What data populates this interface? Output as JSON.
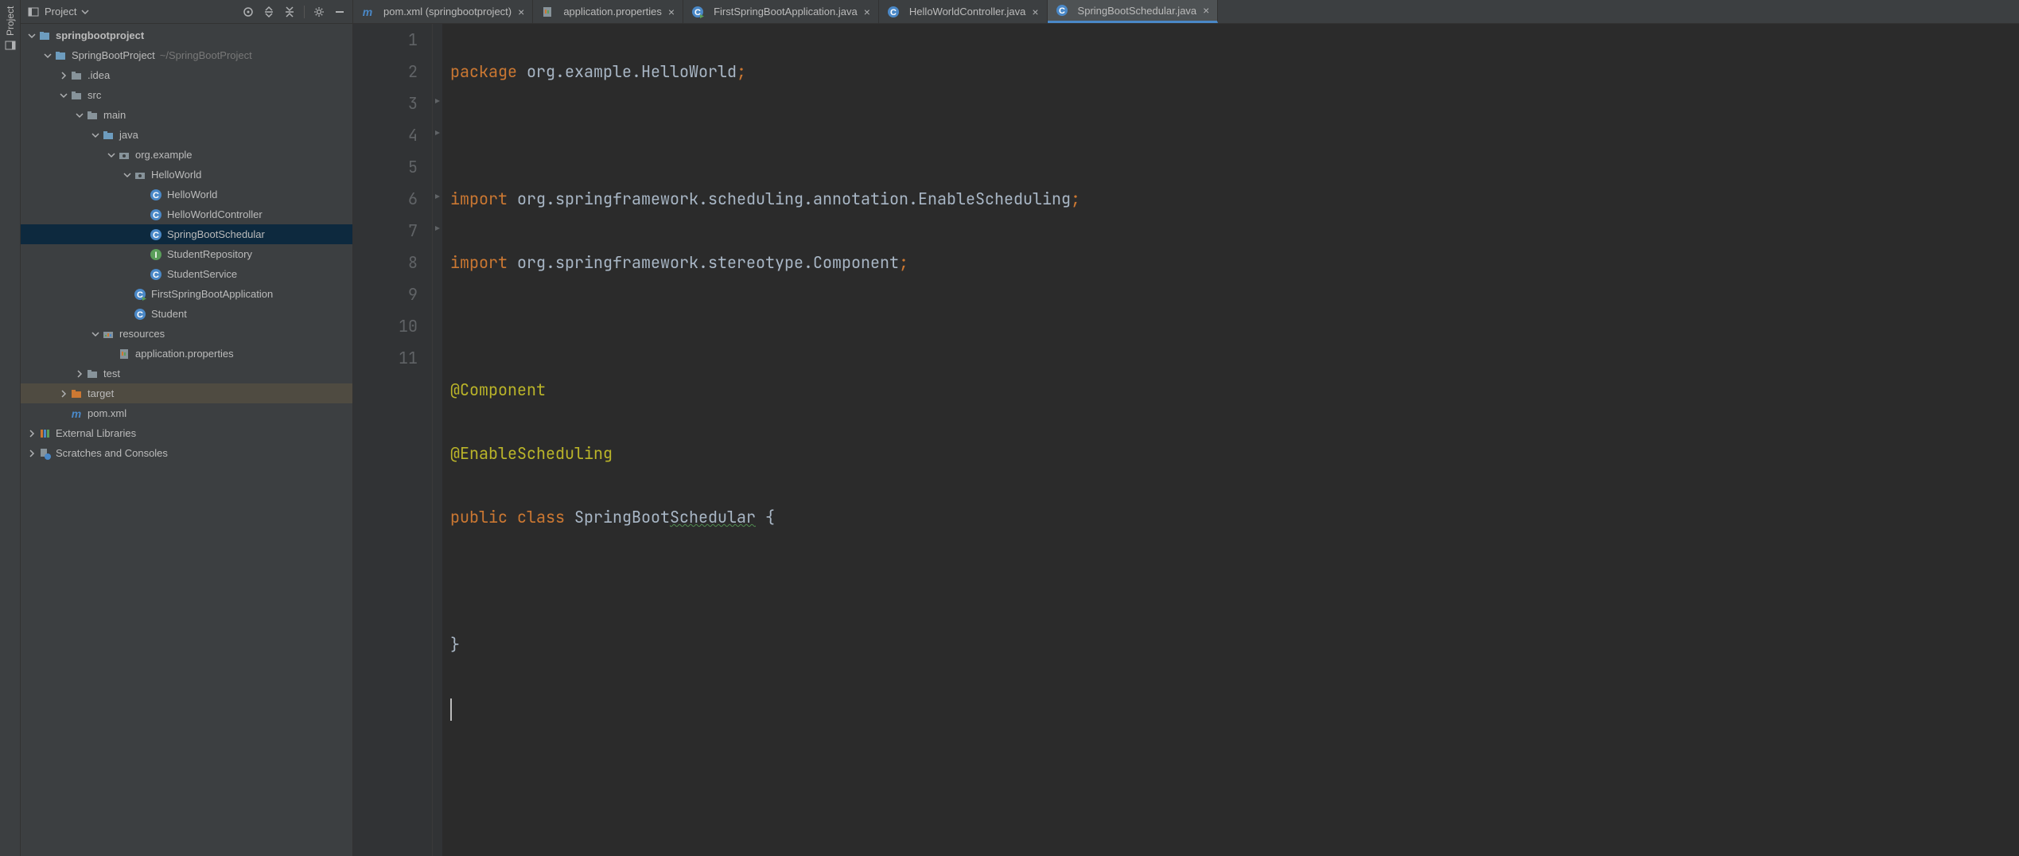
{
  "sidebar_tab": "Project",
  "project_header": {
    "title": "Project"
  },
  "tree": {
    "root": "springbootproject",
    "module": "SpringBootProject",
    "module_path": "~/SpringBootProject",
    "items": {
      "idea": ".idea",
      "src": "src",
      "main": "main",
      "java": "java",
      "pkg": "org.example",
      "helloworld": "HelloWorld",
      "hw": "HelloWorld",
      "hwc": "HelloWorldController",
      "sbs": "SpringBootSchedular",
      "srepo": "StudentRepository",
      "ssvc": "StudentService",
      "fba": "FirstSpringBootApplication",
      "student": "Student",
      "resources": "resources",
      "appprops": "application.properties",
      "test": "test",
      "target": "target",
      "pom": "pom.xml",
      "extlib": "External Libraries",
      "scratch": "Scratches and Consoles"
    }
  },
  "tabs": [
    {
      "label": "pom.xml (springbootproject)"
    },
    {
      "label": "application.properties"
    },
    {
      "label": "FirstSpringBootApplication.java"
    },
    {
      "label": "HelloWorldController.java"
    },
    {
      "label": "SpringBootSchedular.java"
    }
  ],
  "code": {
    "l1_kw": "package",
    "l1_pkg": " org.example.HelloWorld",
    "l3_kw": "import",
    "l3_pkg": " org.springframework.scheduling.annotation.",
    "l3_cls": "EnableScheduling",
    "l4_kw": "import",
    "l4_pkg": " org.springframework.stereotype.",
    "l4_cls": "Component",
    "l6_ann": "@Component",
    "l7_ann": "@EnableScheduling",
    "l8_kw1": "public",
    "l8_kw2": "class",
    "l8_name": "SpringBoot",
    "l8_name2": "Schedular",
    "l8_brace": " {",
    "l10_brace": "}",
    "lines": {
      "1": "1",
      "2": "2",
      "3": "3",
      "4": "4",
      "5": "5",
      "6": "6",
      "7": "7",
      "8": "8",
      "9": "9",
      "10": "10",
      "11": "11"
    }
  }
}
